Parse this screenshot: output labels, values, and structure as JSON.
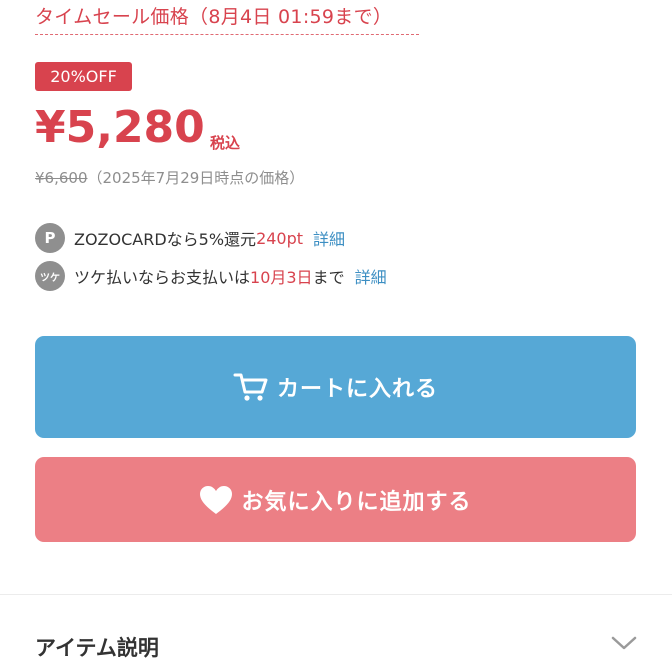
{
  "sale": {
    "title": "タイムセール価格（8月4日 01:59まで）",
    "badge": "20%OFF",
    "price": "¥5,280",
    "tax_label": "税込",
    "original_price": "¥6,600",
    "original_note": "（2025年7月29日時点の価格）"
  },
  "benefits": {
    "points": {
      "icon": "P",
      "text": "ZOZOCARDなら5%還元",
      "amount": "240pt",
      "link": "詳細"
    },
    "tsuke": {
      "icon": "ツケ",
      "text": "ツケ払いならお支払いは",
      "date": "10月3日",
      "suffix": "まで",
      "link": "詳細"
    }
  },
  "buttons": {
    "cart_label": "カートに入れる",
    "cart_icon": "cart-icon",
    "favorite_label": "お気に入りに追加する",
    "favorite_icon": "heart-icon"
  },
  "section": {
    "title": "アイテム説明",
    "toggle_icon": "chevron-down-icon"
  },
  "colors": {
    "accent_red": "#d8434e",
    "cart_blue": "#56a8d6",
    "favorite_pink": "#ec7f85",
    "link_blue": "#3d8fc3"
  }
}
